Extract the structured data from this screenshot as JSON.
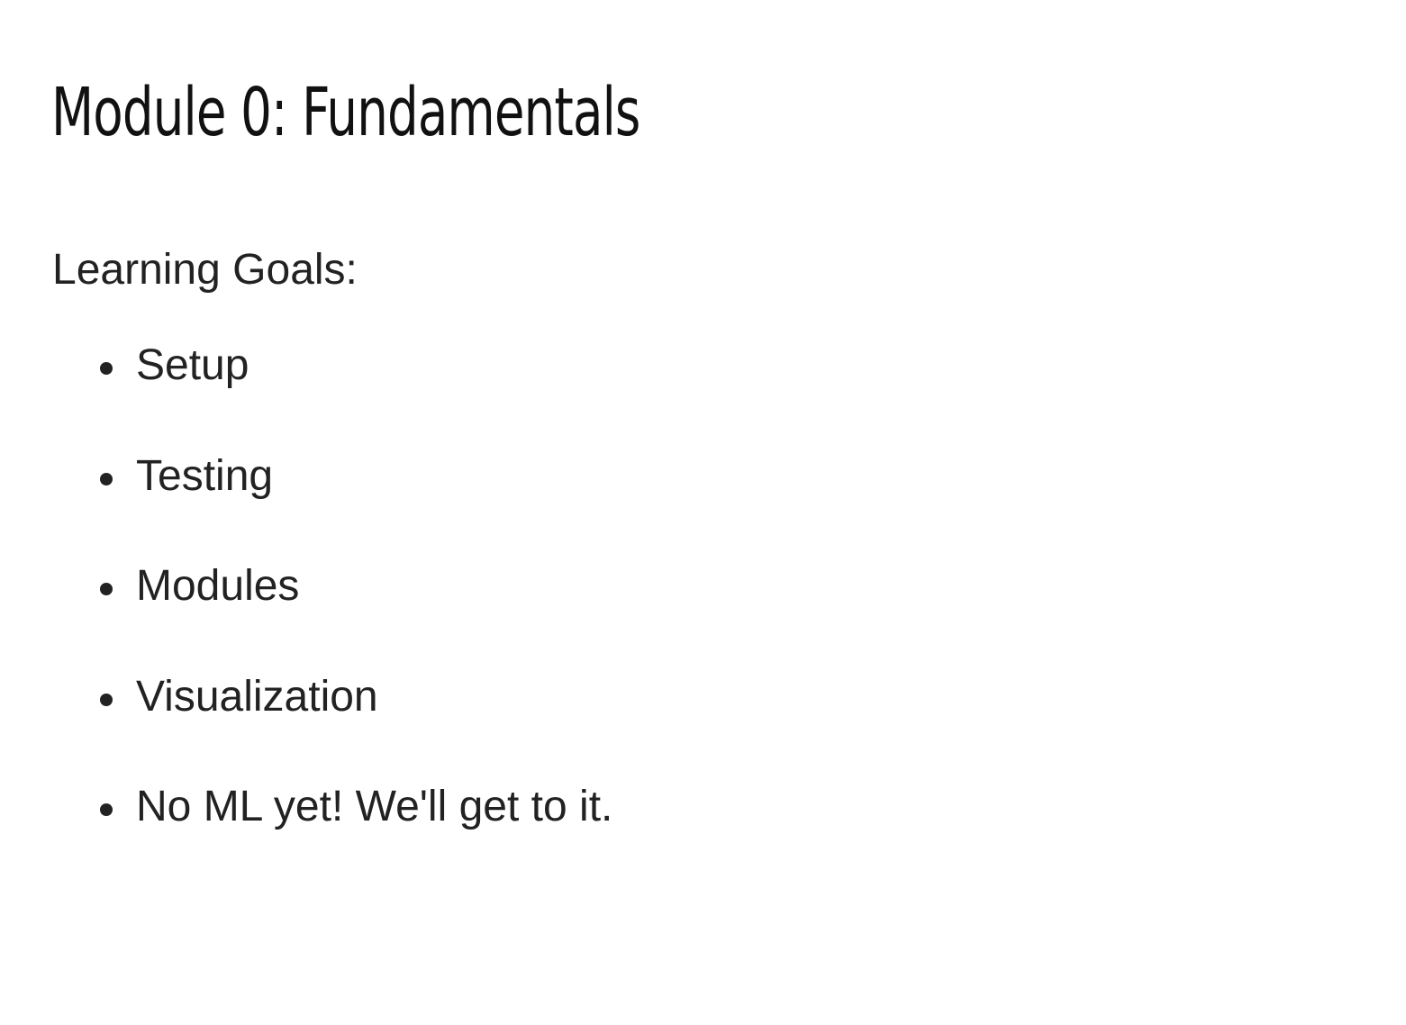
{
  "slide": {
    "title": "Module 0: Fundamentals",
    "goals_label": "Learning Goals:",
    "goals": [
      "Setup",
      "Testing",
      "Modules",
      "Visualization",
      "No ML yet! We'll get to it."
    ]
  },
  "colors": {
    "background": "#ffffff",
    "text": "#222222"
  }
}
